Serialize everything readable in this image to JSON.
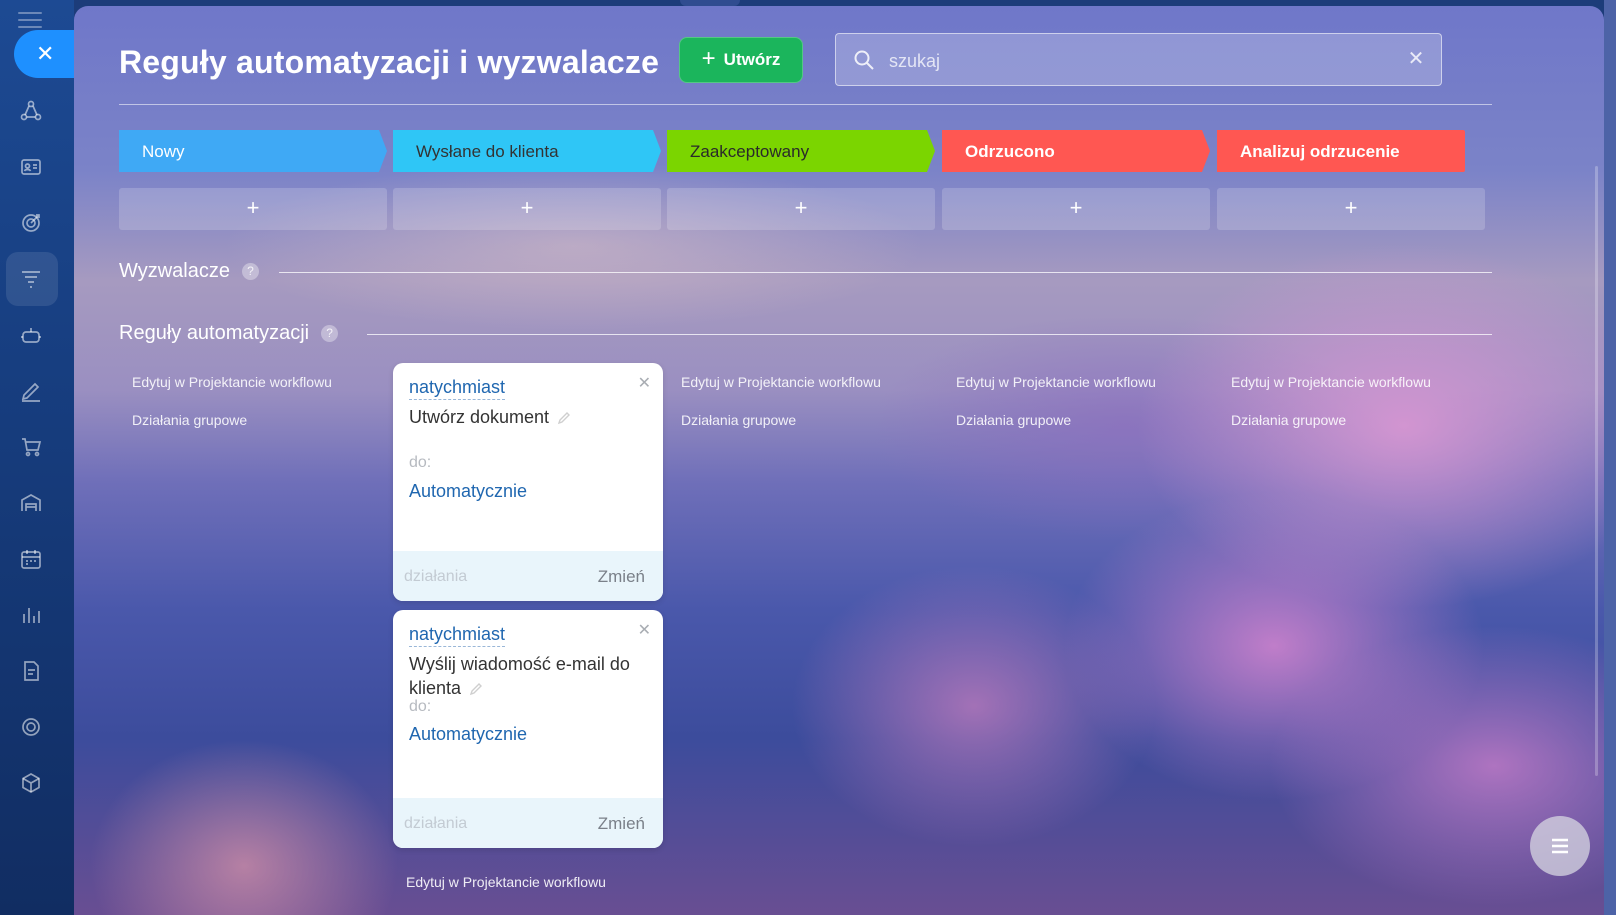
{
  "window": {
    "title": "Reguły automatyzacji i wyzwalacze"
  },
  "rail": {
    "close_icon": "close-icon",
    "items": [
      "crm-icon",
      "contacts-icon",
      "target-icon",
      "funnel-icon",
      "robot-icon",
      "edit-icon",
      "cart-icon",
      "warehouse-icon",
      "calendar-icon",
      "analytics-icon",
      "document-icon",
      "circle-icon",
      "box-icon"
    ],
    "active": "funnel-icon"
  },
  "header": {
    "title": "Reguły automatyzacji i wyzwalacze",
    "create_label": "Utwórz",
    "search_placeholder": "szukaj"
  },
  "stages": [
    {
      "label": "Nowy",
      "color": "#3fa9f5"
    },
    {
      "label": "Wysłane do klienta",
      "color": "#2fc6f6"
    },
    {
      "label": "Zaakceptowany",
      "color": "#7bd500"
    },
    {
      "label": "Odrzucono",
      "color": "#ff5752"
    },
    {
      "label": "Analizuj odrzucenie",
      "color": "#ff5752"
    }
  ],
  "add_symbol": "+",
  "sections": {
    "triggers": "Wyzwalacze",
    "rules": "Reguły automatyzacji"
  },
  "column_links": {
    "edit": "Edytuj w Projektancie workflowu",
    "group": "Działania grupowe"
  },
  "cards": [
    {
      "when": "natychmiast",
      "name": "Utwórz dokument",
      "to_label": "do:",
      "target": "Automatycznie",
      "footer_label": "działania",
      "change_label": "Zmień"
    },
    {
      "when": "natychmiast",
      "name": "Wyślij wiadomość e-mail do klienta",
      "to_label": "do:",
      "target": "Automatycznie",
      "footer_label": "działania",
      "change_label": "Zmień"
    }
  ],
  "bottom_link": "Edytuj w Projektancie workflowu",
  "colors": {
    "accent": "#1bb55c",
    "link": "#2067b0",
    "close": "#1e90ff"
  }
}
